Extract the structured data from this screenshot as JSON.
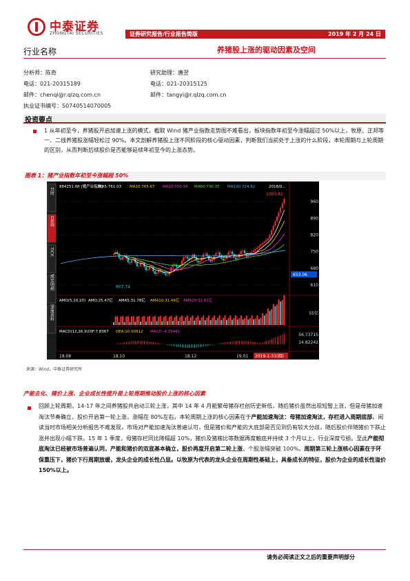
{
  "brand": {
    "name_cn": "中泰证券",
    "name_en": "ZHONGTAI SECURITIES"
  },
  "header": {
    "category": "证券研究报告/行业报告简版",
    "date": "2019 年 2 月 24 日"
  },
  "industry_label": "行业名称",
  "title": "养猪股上涨的驱动因素及空间",
  "analyst": {
    "name": "分析师：陈奇",
    "phone": "电话：021-20315189",
    "email": "邮件：chenqi@r.qlzq.com.cn",
    "cert": "执业证书编号：S0740514070005"
  },
  "assistant": {
    "name": "研究助理：唐翌",
    "phone": "电话：021-20315125",
    "email": "邮件：tangyi@r.qlzq.com.cn"
  },
  "section_title": "投资要点",
  "key_point": "1 从年初至今，养猪股开启加速上涨的模式，截取 Wind 猪产业指数走势图不难看出，板块指数年初至今涨幅超过 50%以上，牧原、正邦等一、二线养猪股涨幅轻松过 90%。本文剖解养猪股上涨不同阶段的核心驱动因素，判断我们当前处于上涨的什么阶段，本轮周期与上轮周期的区别，从而判断后续股价是否能够延续年初至今的上涨态势。",
  "figure": {
    "caption": "图表 1：猪产业指数年初至今涨幅超 50%",
    "source": "来源：Wind，中泰证券研究所",
    "side_tabs": [
      "分时",
      "日K线",
      "TICK",
      "成交明细",
      "深度资料"
    ],
    "top_labels": {
      "code": "884251.WI [猪产业指数]",
      "ma5": "MA5:761.03",
      "ma10": "MA10:765.67",
      "ma20": "MA20:750.34",
      "ma60": "MA60:736.35",
      "ma120": "MA120:724.82",
      "date": "2018/0..."
    },
    "high_label": "1003.82",
    "low_label": "607.74",
    "price_label": "653.06",
    "price_ticks": [
      "960",
      "890",
      "820",
      "750",
      "680",
      "610"
    ],
    "vol_labels": {
      "amo": "AMO(5,10,20)",
      "amo_v": "AMO:25.47亿",
      "ma5": "AMA5:31.78亿",
      "ma10": "AMA10:31.49亿",
      "ma20": "AMA20:32.61亿"
    },
    "vol_tick": "55亿",
    "macd_labels": {
      "macd": "MACD(12,26,9)",
      "dif": "DIF:7.8367",
      "dea": "DEA:10.00812",
      "m": "MACD:-4.35491"
    },
    "macd_ticks": [
      "56.73715",
      "14.82242"
    ],
    "x_ticks": [
      "18.08",
      "18.10",
      "18.12",
      "19.01"
    ],
    "x_cursor": "2019-1-31(四)"
  },
  "chart_data": {
    "type": "line",
    "title": "猪产业指数年初至今涨幅超 50%",
    "x": [
      "18.08",
      "18.10",
      "18.12",
      "19.01"
    ],
    "series": [
      {
        "values": [
          740,
          640,
          760,
          700
        ]
      }
    ],
    "ylim": [
      610,
      1003.82
    ]
  },
  "subsection_title": "产能去化、猪价上涨、企业成长性提升是上轮周期推动股价上涨的核心因素",
  "body": {
    "p1": "回顾上轮周期，14-17 年之间养猪股共启动三轮上涨，其中 14 年 4 月能繁母猪存栏创历史新低，随后猪价虽然出现短暂上涨，但是母猪加速淘汰节奏确立，股价开启第一轮上涨，涨幅在 80%左右。本轮周期上涨的核心因素在于",
    "b1": "产能加速淘汰：母猪加速淘汰，存栏进入周期底部",
    "p2": "。阅读当时市场相关分析报告不难发现，市场对产能加速淘汰普遍认可，但是猪价和产能的大底部是否见到仍有较大分歧，随后股价伴随猪价下跌止涨并出现小幅下跌。15 年 1 季度，母猪存栏同比降幅超 10%，猪价及猪粮比等数据再度触底并持续 3 个月以上，行业深度亏损。至此",
    "b2": "产能彻底淘汰已经被市场普遍认同，产能和猪价的双底基本确立，股价再度开启第二轮上涨",
    "p3": "，个股涨幅突破 100%。",
    "b3": "周期第三轮上涨核心因素在于环保重压下，猪价下行周期放缓，龙头企业的成长性凸显。以牧原为代表的龙头企业在周期性基础上，具备成长的特征，股价为企业的成长性溢价 150%以上。"
  },
  "footer": "请务必阅读正文之后的重要声明部分"
}
